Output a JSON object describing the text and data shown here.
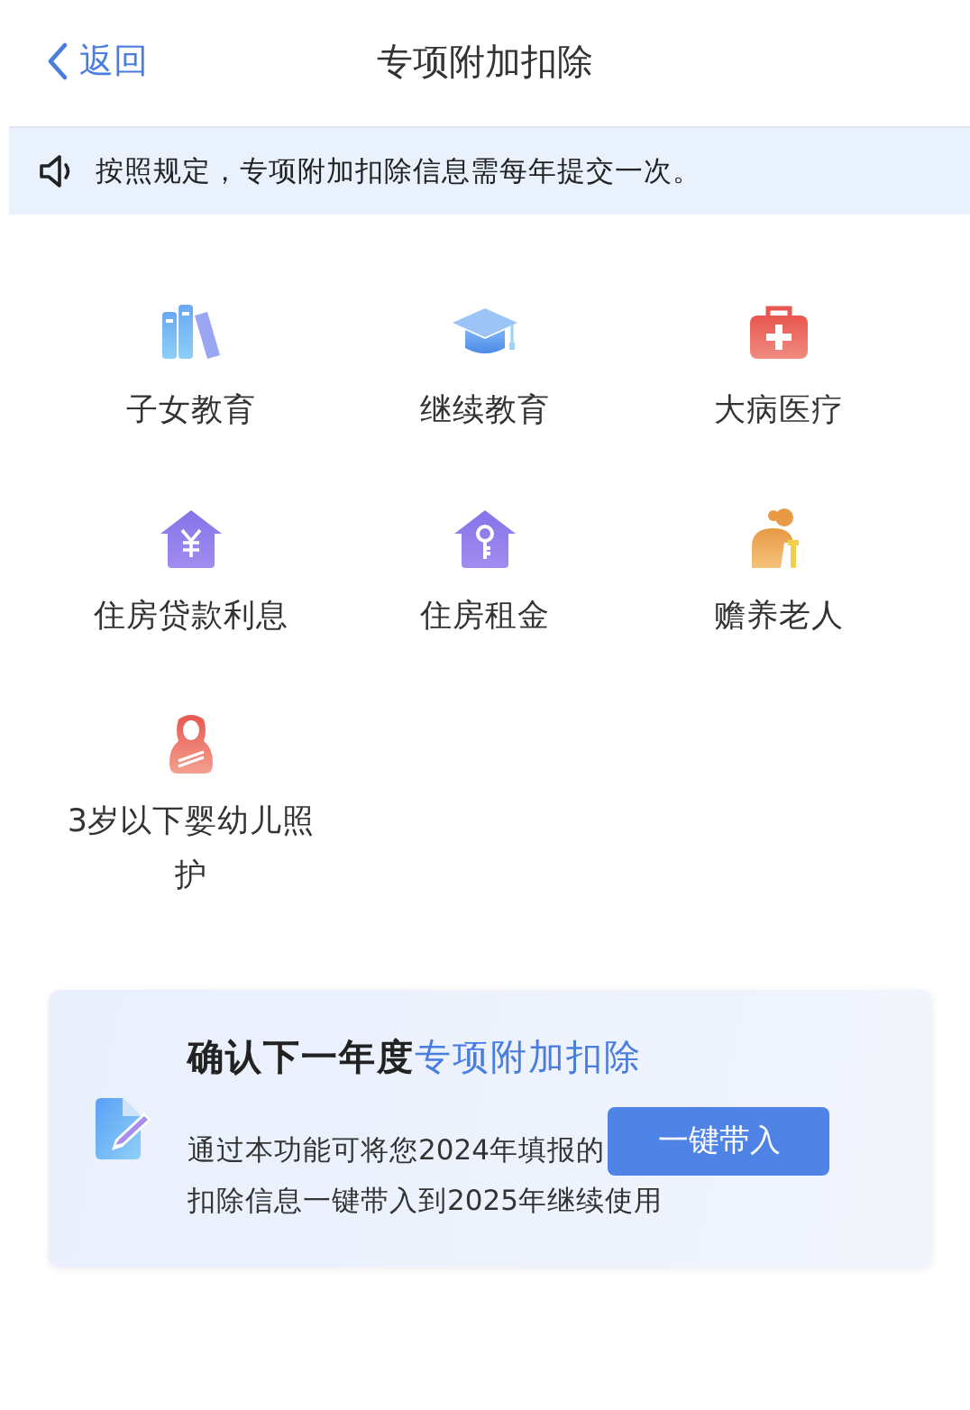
{
  "nav": {
    "back": "返回",
    "title": "专项附加扣除"
  },
  "notice": {
    "text": "按照规定，专项附加扣除信息需每年提交一次。"
  },
  "items": [
    {
      "label": "子女教育"
    },
    {
      "label": "继续教育"
    },
    {
      "label": "大病医疗"
    },
    {
      "label": "住房贷款利息"
    },
    {
      "label": "住房租金"
    },
    {
      "label": "赡养老人"
    },
    {
      "label": "3岁以下婴幼儿照护"
    }
  ],
  "card": {
    "title": "确认下一年度",
    "title_highlight": "专项附加扣除",
    "description_lines": [
      "通过本功能可将您2024年填报的",
      "扣除信息一键带入到2025年继续使用"
    ],
    "button": "一键带入"
  }
}
